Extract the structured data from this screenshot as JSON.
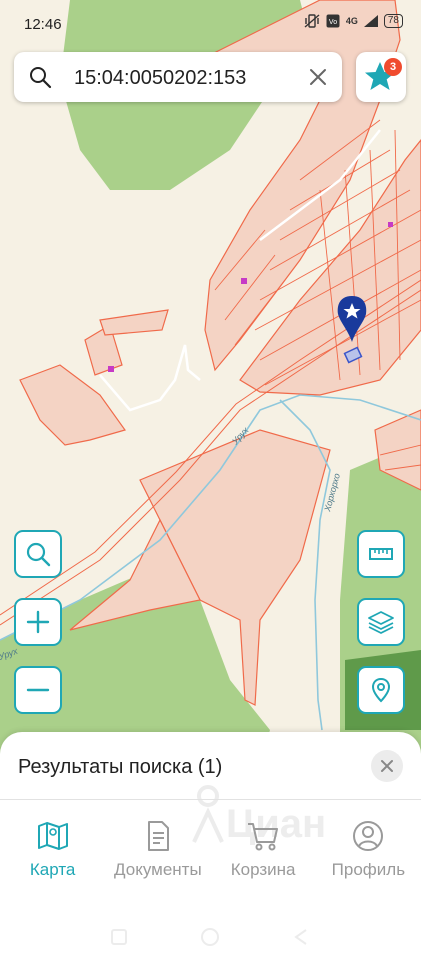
{
  "status_bar": {
    "time": "12:46",
    "network": "4G",
    "battery": "78"
  },
  "search": {
    "value": "15:04:0050202:153"
  },
  "favorites": {
    "badge": "3"
  },
  "map_labels": {
    "river_1": "Урух",
    "river_2": "Хорхорхо",
    "river_3": "Урух"
  },
  "sheet": {
    "title": "Результаты поиска (1)",
    "watermark": "Циан"
  },
  "tabs": [
    {
      "label": "Карта",
      "icon": "map-icon",
      "active": true
    },
    {
      "label": "Документы",
      "icon": "document-icon",
      "active": false
    },
    {
      "label": "Корзина",
      "icon": "cart-icon",
      "active": false
    },
    {
      "label": "Профиль",
      "icon": "profile-icon",
      "active": false
    }
  ],
  "colors": {
    "accent": "#1fa7b5",
    "parcel_border": "#f06a4a",
    "parcel_fill": "#f4d3c4",
    "forest": "#aad08a",
    "marker": "#1a3a9c"
  }
}
